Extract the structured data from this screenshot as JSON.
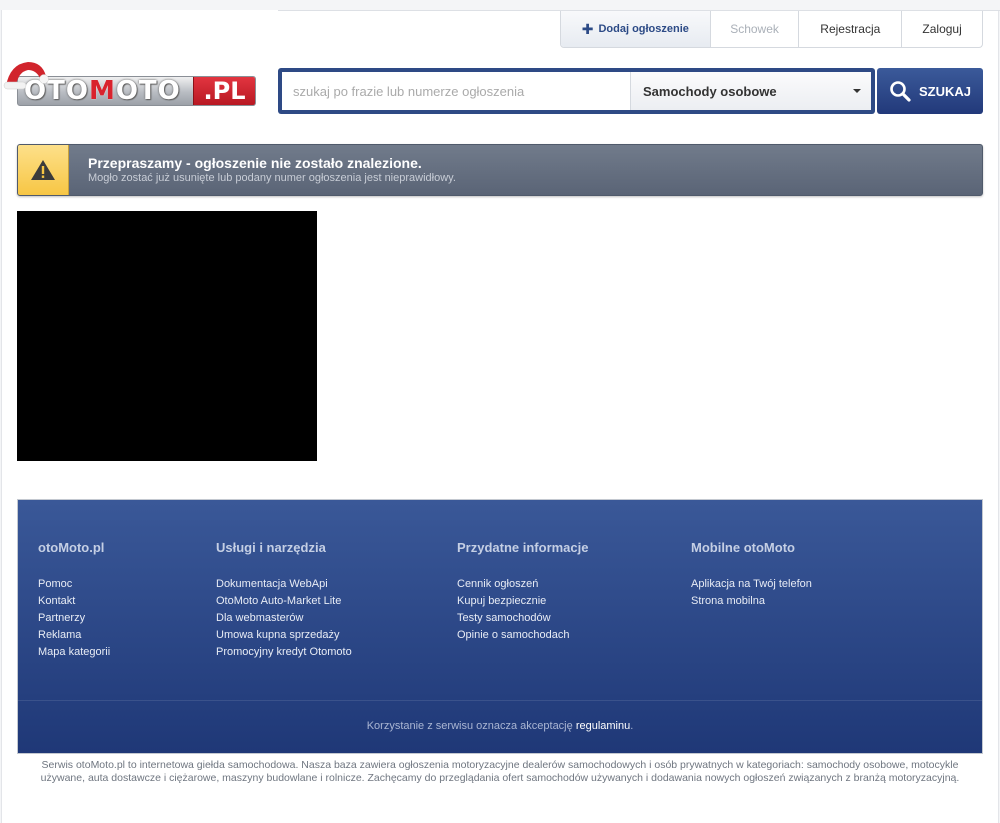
{
  "header": {
    "nav": {
      "add_listing": "Dodaj ogłoszenie",
      "stash": "Schowek",
      "register": "Rejestracja",
      "login": "Zaloguj"
    },
    "logo": {
      "text_main": "OTO",
      "text_m": "M",
      "text_rest": "OTO",
      "text_pl": ".PL"
    },
    "search": {
      "placeholder": "szukaj po frazie lub numerze ogłoszenia",
      "value": "",
      "category": "Samochody osobowe",
      "button_label": "SZUKAJ"
    }
  },
  "alert": {
    "title": "Przepraszamy - ogłoszenie nie zostało znalezione.",
    "subtitle": "Mogło zostać już usunięte lub podany numer ogłoszenia jest nieprawidłowy."
  },
  "footer": {
    "columns": [
      {
        "heading": "otoMoto.pl",
        "links": [
          "Pomoc",
          "Kontakt",
          "Partnerzy",
          "Reklama",
          "Mapa kategorii"
        ]
      },
      {
        "heading": "Usługi i narzędzia",
        "links": [
          "Dokumentacja WebApi",
          "OtoMoto Auto-Market Lite",
          "Dla webmasterów",
          "Umowa kupna sprzedaży",
          "Promocyjny kredyt Otomoto"
        ]
      },
      {
        "heading": "Przydatne informacje",
        "links": [
          "Cennik ogłoszeń",
          "Kupuj bezpiecznie",
          "Testy samochodów",
          "Opinie o samochodach"
        ]
      },
      {
        "heading": "Mobilne otoMoto",
        "links": [
          "Aplikacja na Twój telefon",
          "Strona mobilna"
        ]
      }
    ],
    "terms_prefix": "Korzystanie z serwisu oznacza akceptację ",
    "terms_link": "regulaminu",
    "terms_suffix": "."
  },
  "seo_text": "Serwis otoMoto.pl to internetowa giełda samochodowa. Nasza baza zawiera ogłoszenia motoryzacyjne dealerów samochodowych i osób prywatnych w kategoriach: samochody osobowe, motocykle używane, auta dostawcze i ciężarowe, maszyny budowlane i rolnicze. Zachęcamy do przeglądania ofert samochodów używanych i dodawania nowych ogłoszeń związanych z branżą motoryzacyjną.",
  "colors": {
    "brand_blue": "#2e4a85",
    "brand_red": "#d9232d",
    "alert_bg": "#5a6476",
    "alert_icon_bg": "#f7c644"
  }
}
